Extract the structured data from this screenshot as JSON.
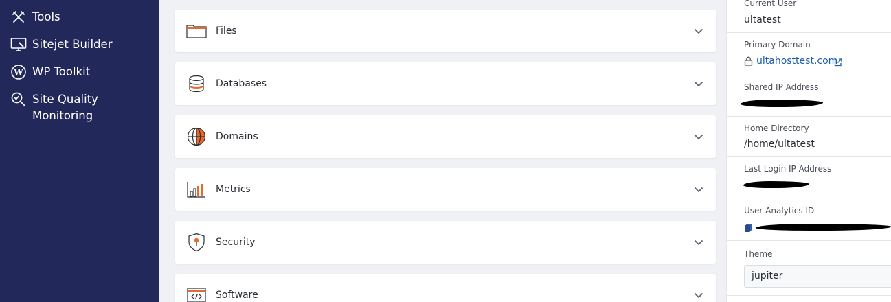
{
  "sidebar": {
    "items": [
      {
        "label": "Tools",
        "icon": "tools-icon"
      },
      {
        "label": "Sitejet Builder",
        "icon": "sitejet-monitor-icon"
      },
      {
        "label": "WP Toolkit",
        "icon": "wordpress-icon"
      },
      {
        "label": "Site Quality\nMonitoring",
        "icon": "magnifier-check-icon"
      }
    ]
  },
  "panels": [
    {
      "title": "Files",
      "icon": "folder-icon"
    },
    {
      "title": "Databases",
      "icon": "database-icon"
    },
    {
      "title": "Domains",
      "icon": "globe-icon"
    },
    {
      "title": "Metrics",
      "icon": "bar-chart-icon"
    },
    {
      "title": "Security",
      "icon": "shield-icon"
    },
    {
      "title": "Software",
      "icon": "code-window-icon"
    }
  ],
  "info": {
    "current_user_label": "Current User",
    "current_user": "ultatest",
    "primary_domain_label": "Primary Domain",
    "primary_domain": "ultahosttest.com",
    "shared_ip_label": "Shared IP Address",
    "home_dir_label": "Home Directory",
    "home_dir": "/home/ultatest",
    "last_login_label": "Last Login IP Address",
    "analytics_label": "User Analytics ID",
    "theme_label": "Theme",
    "theme_value": "jupiter"
  },
  "colors": {
    "sidebar_bg": "#22285a",
    "accent_orange": "#e8692c",
    "link_blue": "#1f5ea8"
  }
}
